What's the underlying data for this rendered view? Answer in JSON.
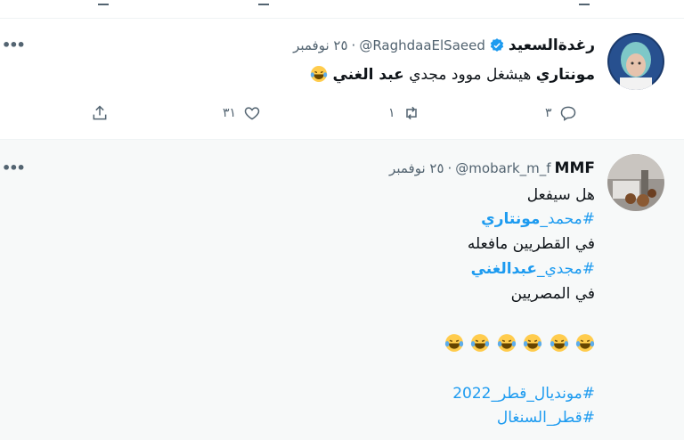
{
  "tweets": [
    {
      "name": "رغدةالسعيد",
      "verified": true,
      "handle": "@RaghdaaElSaeed",
      "dot": "·",
      "time": "٢٥ نوفمبر",
      "text_a": "مونتاري",
      "text_b": " هيشغل موود مجدي ",
      "text_c": "عبد الغني",
      "emoji": "laughing-tears-emoji",
      "reply_count": "٣",
      "retweet_count": "١",
      "like_count": "٣١"
    },
    {
      "name": "MMF",
      "handle": "@mobark_m_f",
      "dot": "·",
      "time": "٢٥ نوفمبر",
      "line1": "هل سيفعل",
      "hashtag1_a": "#محمد_",
      "hashtag1_b": "مونتاري",
      "line3": "في القطريين مافعله",
      "hashtag2_a": "#مجدي_",
      "hashtag2_b": "عبدالغني",
      "line5": "في المصريين",
      "hashtag3": "#مونديال_قطر_2022",
      "hashtag4": "#قطر_السنغال"
    }
  ],
  "colors": {
    "accent": "#1d9bf0",
    "muted": "#536471",
    "text": "#0f1419"
  }
}
